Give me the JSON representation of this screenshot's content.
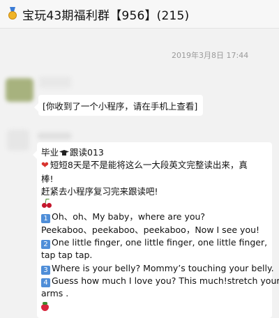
{
  "header": {
    "title": "宝玩43期福利群【956】(215)",
    "icon": "gold-medal-icon"
  },
  "timestamp": "2019年3月8日 17:44",
  "messages": [
    {
      "text": "[你收到了一个小程序，请在手机上查看]"
    },
    {
      "title_a": "毕业",
      "title_b": "跟读013",
      "line1": "短短8天是不是能将这么一大段英文完整读出来，真",
      "line2": "棒!",
      "line3": "赶紧去小程序复习完来跟读吧!",
      "items": [
        {
          "num": "1",
          "l1": "Oh、oh、My baby，where are you?",
          "l2": "Peekaboo、peekaboo、peekaboo，Now I see you!"
        },
        {
          "num": "2",
          "l1": "One little finger, one little finger, one little finger,",
          "l2": "tap tap tap."
        },
        {
          "num": "3",
          "l1": "Where is your belly? Mommy’s touching your belly.",
          "l2": ""
        },
        {
          "num": "4",
          "l1": "Guess how much I love you? This much!stretch your",
          "l2": "arms ."
        }
      ]
    }
  ]
}
